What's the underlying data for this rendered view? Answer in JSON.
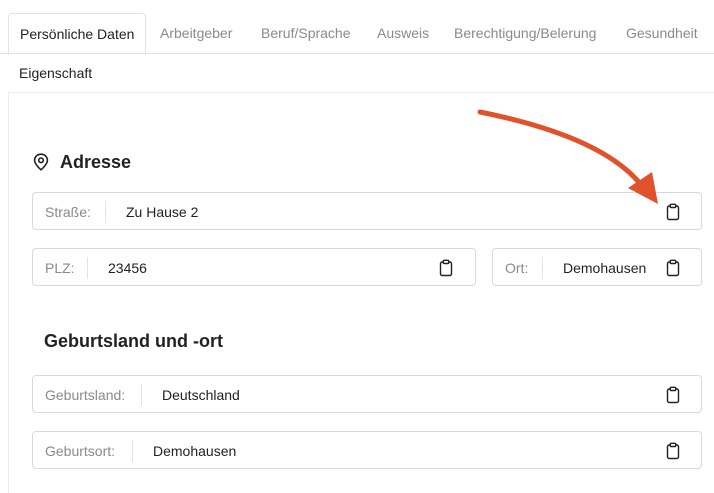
{
  "tabs": [
    {
      "label": "Persönliche Daten",
      "active": true
    },
    {
      "label": "Arbeitgeber"
    },
    {
      "label": "Beruf/Sprache"
    },
    {
      "label": "Ausweis"
    },
    {
      "label": "Berechtigung/Belerung"
    },
    {
      "label": "Gesundheit"
    }
  ],
  "tab_row2": {
    "label": "Eigenschaft"
  },
  "address": {
    "title": "Adresse",
    "icon": "map-pin-icon",
    "street": {
      "label": "Straße:",
      "value": "Zu Hause 2"
    },
    "zip": {
      "label": "PLZ:",
      "value": "23456"
    },
    "city": {
      "label": "Ort:",
      "value": "Demohausen"
    }
  },
  "birth": {
    "title": "Geburtsland und -ort",
    "country": {
      "label": "Geburtsland:",
      "value": "Deutschland"
    },
    "place": {
      "label": "Geburtsort:",
      "value": "Demohausen"
    }
  },
  "annotation": {
    "icon": "arrow-annotation",
    "color": "#e0522b"
  }
}
